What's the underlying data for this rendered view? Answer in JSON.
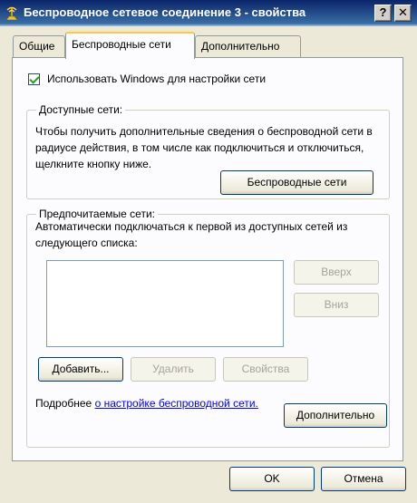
{
  "window": {
    "title": "Беспроводное сетевое соединение 3 - свойства",
    "help_label": "?",
    "close_label": "✕"
  },
  "tabs": [
    {
      "label": "Общие",
      "active": false
    },
    {
      "label": "Беспроводные сети",
      "active": true
    },
    {
      "label": "Дополнительно",
      "active": false
    }
  ],
  "use_windows": {
    "label": "Использовать Windows для настройки сети",
    "checked": true
  },
  "available_networks": {
    "heading": "Доступные сети:",
    "description": "Чтобы получить дополнительные сведения о беспроводной сети в радиусе действия, в том числе как подключиться и отключиться, щелкните кнопку ниже.",
    "button_label": "Беспроводные сети"
  },
  "preferred_networks": {
    "heading": "Предпочитаемые сети:",
    "description": "Автоматически подключаться к первой из доступных сетей из следующего списка:",
    "items": [],
    "up_label": "Вверх",
    "down_label": "Вниз",
    "add_label": "Добавить...",
    "remove_label": "Удалить",
    "properties_label": "Свойства"
  },
  "learn_more": {
    "prefix": "Подробнее",
    "link_text": "о настройке беспроводной сети."
  },
  "advanced_button_label": "Дополнительно",
  "footer": {
    "ok_label": "OK",
    "cancel_label": "Отмена"
  }
}
